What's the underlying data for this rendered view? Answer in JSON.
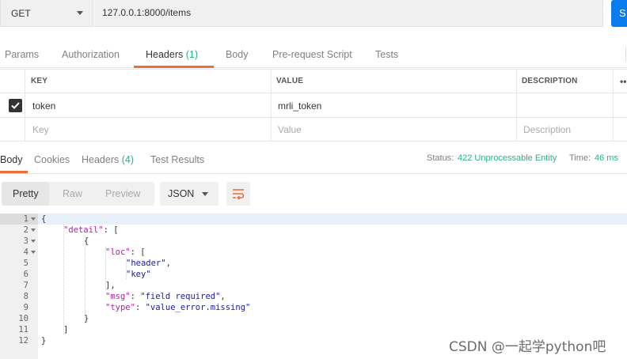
{
  "request": {
    "method": "GET",
    "url": "127.0.0.1:8000/items",
    "send_label": "S"
  },
  "request_tabs": [
    {
      "label": "Params"
    },
    {
      "label": "Authorization"
    },
    {
      "label": "Headers",
      "count": "(1)",
      "active": true
    },
    {
      "label": "Body"
    },
    {
      "label": "Pre-request Script"
    },
    {
      "label": "Tests"
    }
  ],
  "headers_table": {
    "columns": [
      "KEY",
      "VALUE",
      "DESCRIPTION"
    ],
    "rows": [
      {
        "checked": true,
        "key": "token",
        "value": "mrli_token",
        "description": ""
      }
    ],
    "placeholders": {
      "key": "Key",
      "value": "Value",
      "description": "Description"
    },
    "more": "••"
  },
  "response_tabs": [
    {
      "label": "Body",
      "active": true
    },
    {
      "label": "Cookies"
    },
    {
      "label": "Headers",
      "count": "(4)"
    },
    {
      "label": "Test Results"
    }
  ],
  "status": {
    "status_label": "Status:",
    "status_value": "422 Unprocessable Entity",
    "time_label": "Time:",
    "time_value": "46 ms"
  },
  "view": {
    "modes": [
      "Pretty",
      "Raw",
      "Preview"
    ],
    "active_mode": "Pretty",
    "format": "JSON"
  },
  "code_lines": [
    {
      "n": "1",
      "text": "{"
    },
    {
      "n": "2",
      "text": "\"detail\": ["
    },
    {
      "n": "3",
      "text": "{"
    },
    {
      "n": "4",
      "text": "\"loc\": ["
    },
    {
      "n": "5",
      "text": "\"header\","
    },
    {
      "n": "6",
      "text": "\"key\""
    },
    {
      "n": "7",
      "text": "],"
    },
    {
      "n": "8",
      "text": "\"msg\": \"field required\","
    },
    {
      "n": "9",
      "text": "\"type\": \"value_error.missing\""
    },
    {
      "n": "10",
      "text": "}"
    },
    {
      "n": "11",
      "text": "]"
    },
    {
      "n": "12",
      "text": "}"
    }
  ],
  "json_tokens": {
    "detail_key": "\"detail\"",
    "loc_key": "\"loc\"",
    "loc_header": "\"header\"",
    "loc_key_value": "\"key\"",
    "msg_key": "\"msg\"",
    "msg_value": "\"field required\"",
    "type_key": "\"type\"",
    "type_value": "\"value_error.missing\""
  },
  "watermark": "CSDN @一起学python吧",
  "colors": {
    "accent_orange": "#f26b3a",
    "success_green": "#26b47f",
    "send_blue": "#097bed"
  }
}
